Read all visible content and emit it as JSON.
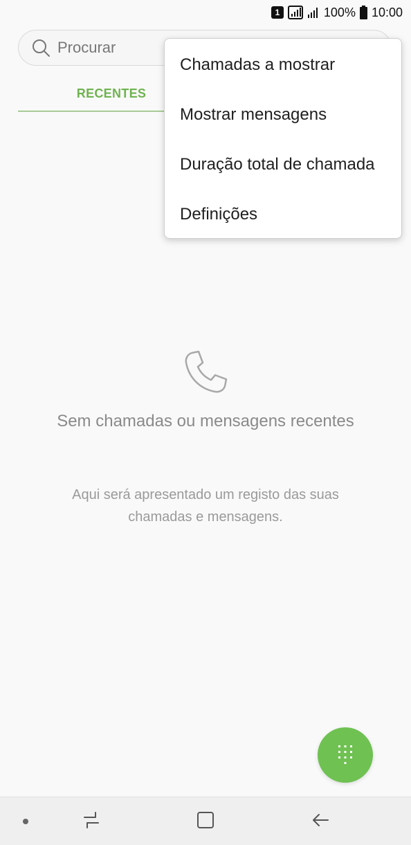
{
  "status_bar": {
    "sim_number": "1",
    "battery_percent": "100%",
    "time": "10:00"
  },
  "search": {
    "placeholder": "Procurar"
  },
  "tabs": [
    {
      "label": "RECENTES",
      "active": true
    },
    {
      "label": "",
      "active": false
    }
  ],
  "overflow_menu": {
    "items": [
      {
        "label": "Chamadas a mostrar"
      },
      {
        "label": "Mostrar mensagens"
      },
      {
        "label": "Duração total de chamada"
      },
      {
        "label": "Definições"
      }
    ]
  },
  "empty_state": {
    "title": "Sem chamadas ou mensagens recentes",
    "description": "Aqui será apresentado um registo das suas chamadas e mensagens."
  },
  "icons": {
    "search": "search-icon",
    "phone": "phone-icon",
    "dialpad": "dialpad-icon",
    "recents": "recents-icon",
    "home": "home-icon",
    "back": "back-icon"
  },
  "colors": {
    "accent": "#6fb34f",
    "fab": "#6fc152",
    "background": "#f9f9f9"
  }
}
